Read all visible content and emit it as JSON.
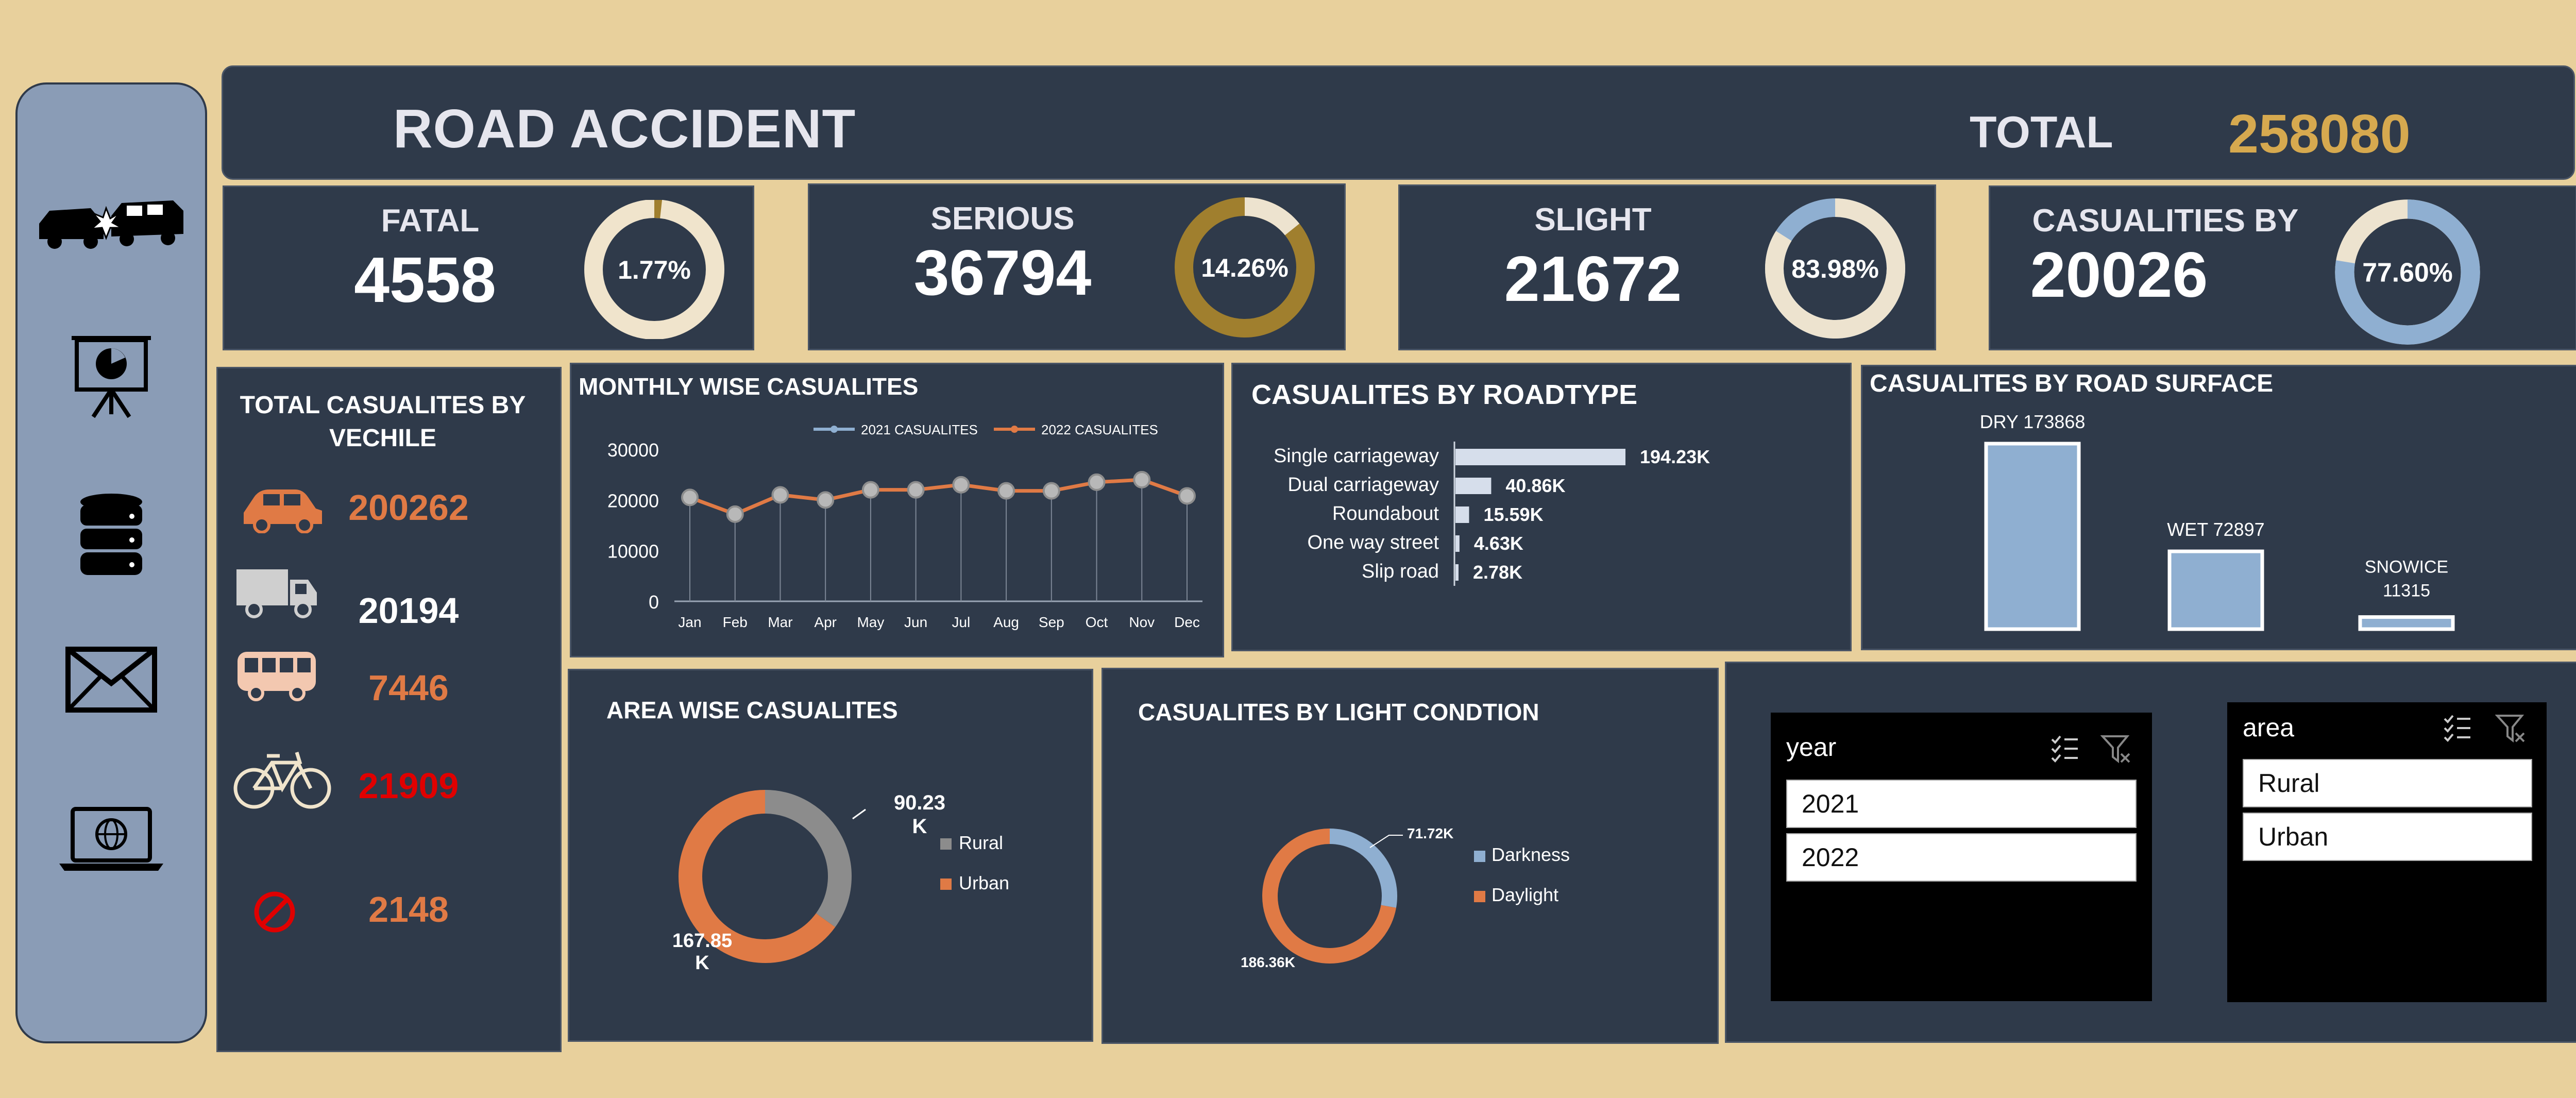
{
  "header": {
    "title": "ROAD ACCIDENT",
    "total_label": "TOTAL",
    "total_value": "258080"
  },
  "sidebar": {
    "icons": [
      "car-crash-icon",
      "presentation-icon",
      "database-icon",
      "mail-icon",
      "laptop-globe-icon"
    ]
  },
  "kpis": [
    {
      "label": "FATAL",
      "value": "4558",
      "pct_label": "1.77%",
      "fraction": 0.0177,
      "color": "#A07F2E",
      "rest_color": "#F0E4CC"
    },
    {
      "label": "SERIOUS",
      "value": "36794",
      "pct_label": "14.26%",
      "fraction": 0.1426,
      "color": "#EDE3CF",
      "rest_color": "#A07F2E"
    },
    {
      "label": "SLIGHT",
      "value": "21672",
      "pct_label": "83.98%",
      "fraction": 0.8398,
      "color": "#EDE3CF",
      "rest_color": "#8FAFD1"
    },
    {
      "label": "CASUALITIES BY",
      "value": "20026",
      "pct_label": "77.60%",
      "fraction": 0.776,
      "color": "#8FAFD1",
      "rest_color": "#EDE3CF"
    }
  ],
  "vehicle": {
    "title": "TOTAL CASUALITES BY VECHILE",
    "items": [
      {
        "icon": "car-icon",
        "value": "200262",
        "color": "#E07A45"
      },
      {
        "icon": "truck-icon",
        "value": "20194",
        "color": "#FFFFFF"
      },
      {
        "icon": "bus-icon",
        "value": "7446",
        "color": "#E07A45"
      },
      {
        "icon": "bicycle-icon",
        "value": "21909",
        "color": "#E00000"
      },
      {
        "icon": "prohibited-icon",
        "value": "2148",
        "color": "#E07A45"
      }
    ]
  },
  "chart_data": [
    {
      "type": "line",
      "title": "MONTHLY WISE CASUALITES",
      "categories": [
        "Jan",
        "Feb",
        "Mar",
        "Apr",
        "May",
        "Jun",
        "Jul",
        "Aug",
        "Sep",
        "Oct",
        "Nov",
        "Dec"
      ],
      "series": [
        {
          "name": "2021 CASUALITES",
          "color": "#8FAFD1",
          "values": [
            20500,
            17200,
            21000,
            20000,
            22000,
            22000,
            23000,
            21800,
            21800,
            23500,
            24000,
            20800
          ]
        },
        {
          "name": "2022 CASUALITES",
          "color": "#E07A45",
          "values": [
            20500,
            17200,
            21000,
            20000,
            22000,
            22000,
            23000,
            21800,
            21800,
            23500,
            24000,
            20800
          ]
        }
      ],
      "yticks": [
        "0",
        "10000",
        "20000",
        "30000"
      ],
      "ylim": [
        0,
        30000
      ]
    },
    {
      "type": "bar",
      "orientation": "horizontal",
      "title": "CASUALITES BY ROADTYPE",
      "categories": [
        "Single carriageway",
        "Dual carriageway",
        "Roundabout",
        "One way street",
        "Slip road"
      ],
      "values": [
        194230,
        40860,
        15590,
        4630,
        2780
      ],
      "labels": [
        "194.23K",
        "40.86K",
        "15.59K",
        "4.63K",
        "2.78K"
      ],
      "color": "#D6DEEB"
    },
    {
      "type": "bar",
      "title": "CASUALITES BY ROAD SURFACE",
      "categories": [
        "DRY",
        "WET",
        "SNOWICE"
      ],
      "values": [
        173868,
        72897,
        11315
      ],
      "labels": [
        "DRY 173868",
        "WET 72897",
        "SNOWICE 11315"
      ],
      "color": "#8FAFD1"
    },
    {
      "type": "pie",
      "title": "AREA WISE CASUALITES",
      "categories": [
        "Rural",
        "Urban"
      ],
      "values": [
        90.23,
        167.85
      ],
      "labels": [
        "90.23 K",
        "167.85 K"
      ],
      "colors": [
        "#8C8C8C",
        "#E07A45"
      ]
    },
    {
      "type": "pie",
      "title": "CASUALITES BY LIGHT CONDTION",
      "categories": [
        "Darkness",
        "Daylight"
      ],
      "values": [
        71.72,
        186.36
      ],
      "labels": [
        "71.72K",
        "186.36K"
      ],
      "colors": [
        "#8FAFD1",
        "#E07A45"
      ]
    }
  ],
  "slicers": [
    {
      "title": "year",
      "items": [
        "2021",
        "2022"
      ]
    },
    {
      "title": "area",
      "items": [
        "Rural",
        "Urban"
      ]
    }
  ]
}
